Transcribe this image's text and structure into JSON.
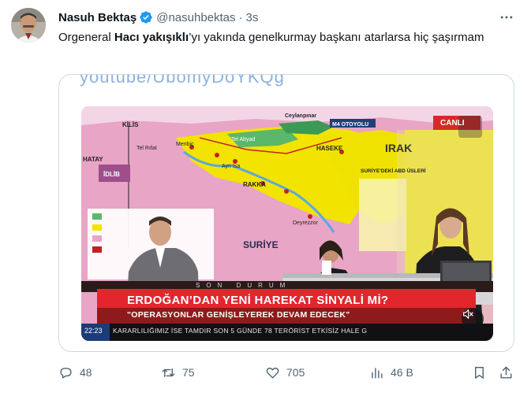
{
  "tweet": {
    "author": {
      "display_name": "Nasuh Bektaş",
      "handle": "@nasuhbektas",
      "verified": true,
      "verified_color": "#1d9bf0",
      "avatar_icon": "user-avatar"
    },
    "separator": "·",
    "timestamp": "3s",
    "text": {
      "part1": "Orgeneral ",
      "bold": "Hacı yakışıklı",
      "part2": "’yı yakında genelkurmay başkanı atarlarsa hiç şaşırmam"
    },
    "media": {
      "cropped_header_text": "youtube/UbomyDoYKQg",
      "video": {
        "channel_logo": "CANLI",
        "breaking_label": "SON DURUM",
        "headline": "ERDOĞAN’DAN YENİ HAREKAT SİNYALİ Mİ?",
        "subheadline": "\"OPERASYONLAR GENİŞLEYEREK DEVAM EDECEK\"",
        "clock": "22:23",
        "ticker": "KARARLILIĞIMIZ İSE TAMDIR       SON 5 GÜNDE 78 TERÖRİST ETKİSİZ HALE G",
        "map_labels": {
          "kilis": "KİLİS",
          "tel_rifat": "Tel Rıfat",
          "menbic": "Menbiç",
          "ayn_isa": "Ayn Isa",
          "tel_abyad": "Tel Abyad",
          "ceylanpinar": "Ceylanpınar",
          "m4": "M4 OTOYOLU",
          "haseke": "HASEKE",
          "irak": "IRAK",
          "rakka": "RAKKA",
          "deyrezzor": "Deyrezzor",
          "suriye": "SURİYE",
          "hatay": "HATAY",
          "idlib": "İDLİB",
          "suriye_abd": "SURİYE'DEKİ ABD ÜSLERİ"
        },
        "mute_icon": "speaker-muted-icon"
      }
    },
    "actions": {
      "reply": {
        "icon": "reply-icon",
        "count": "48"
      },
      "retweet": {
        "icon": "retweet-icon",
        "count": "75"
      },
      "like": {
        "icon": "heart-icon",
        "count": "705"
      },
      "views": {
        "icon": "analytics-icon",
        "count": "46 B"
      },
      "bookmark": {
        "icon": "bookmark-icon"
      },
      "share": {
        "icon": "share-icon"
      }
    },
    "colors": {
      "text": "#0f1419",
      "secondary": "#536471",
      "border": "#cfd9de",
      "breaking_red": "#e3262e"
    }
  }
}
